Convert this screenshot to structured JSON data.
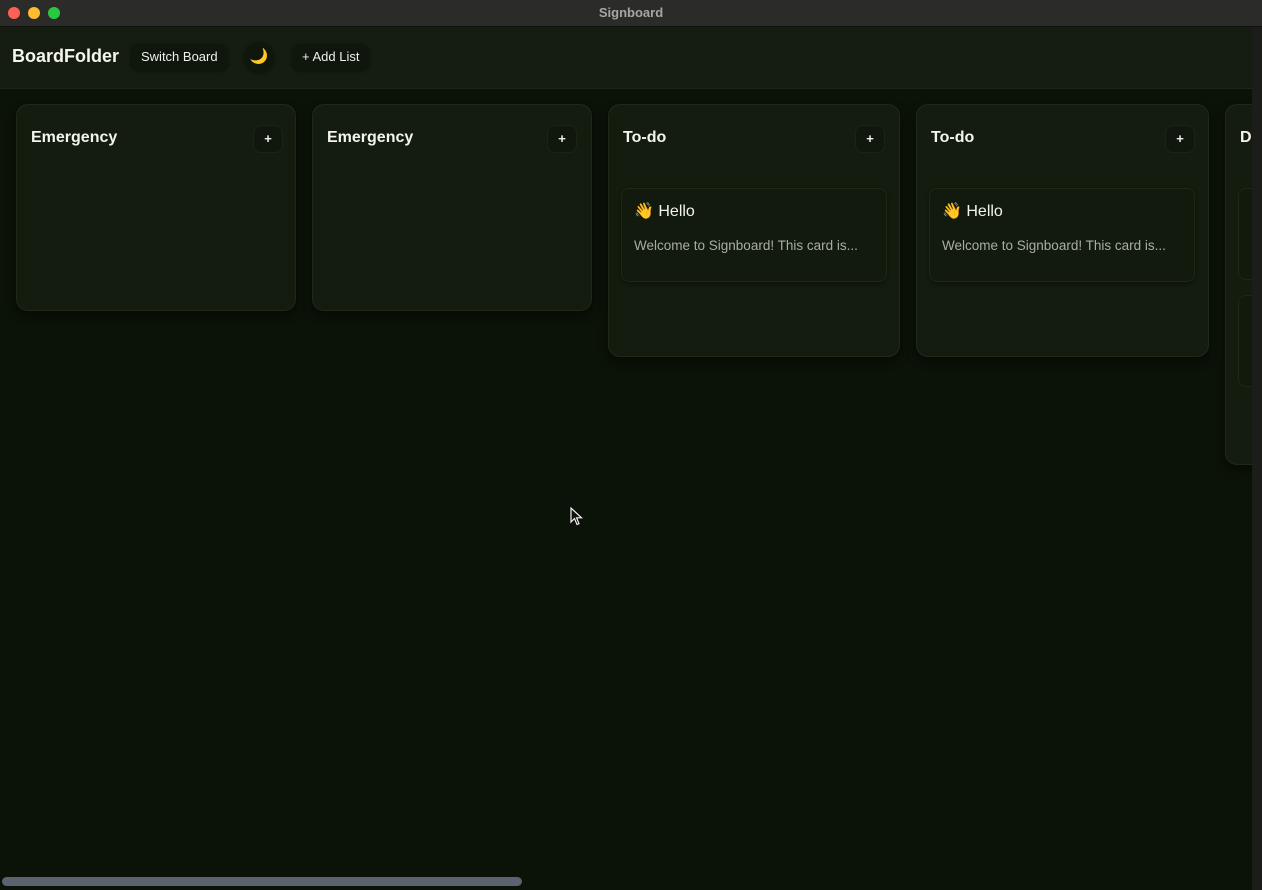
{
  "window": {
    "title": "Signboard"
  },
  "toolbar": {
    "app_name": "BoardFolder",
    "switch_board": "Switch Board",
    "theme_icon": "🌙",
    "add_list": "+ Add List"
  },
  "lists": [
    {
      "title": "Emergency",
      "add": "+",
      "cards": []
    },
    {
      "title": "Emergency",
      "add": "+",
      "cards": []
    },
    {
      "title": "To-do",
      "add": "+",
      "cards": [
        {
          "title": "👋 Hello",
          "text": "Welcome to Signboard! This card is..."
        }
      ]
    },
    {
      "title": "To-do",
      "add": "+",
      "cards": [
        {
          "title": "👋 Hello",
          "text": "Welcome to Signboard! This card is..."
        }
      ]
    },
    {
      "title": "D",
      "add": "",
      "cards": []
    }
  ],
  "colors": {
    "background": "#0b1207",
    "list_bg": "#141c0f",
    "card_bg": "#111a0c",
    "scrollbar": "#5b6270"
  }
}
